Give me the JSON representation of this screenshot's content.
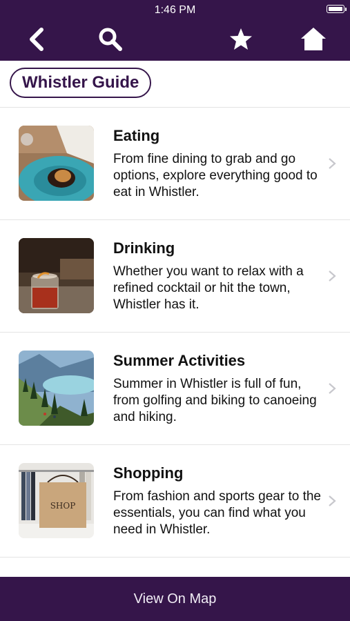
{
  "status_bar": {
    "time": "1:46 PM"
  },
  "nav": {
    "back_icon": "back-arrow-icon",
    "search_icon": "search-icon",
    "favorite_icon": "star-icon",
    "home_icon": "home-icon"
  },
  "filter": {
    "label": "Whistler Guide"
  },
  "items": [
    {
      "title": "Eating",
      "description": "From fine dining to grab and go options, explore everything good to eat in Whistler."
    },
    {
      "title": "Drinking",
      "description": "Whether you want to relax with a refined cocktail or hit the town, Whistler has it."
    },
    {
      "title": "Summer Activities",
      "description": "Summer in Whistler is full of fun, from golfing and biking to canoeing and hiking."
    },
    {
      "title": "Shopping",
      "description": "From fashion and sports gear to the essentials, you can find what you need in Whistler.",
      "image_text": "SHOP"
    }
  ],
  "footer": {
    "label": "View On Map"
  },
  "colors": {
    "brand": "#35154a",
    "divider": "#e4e4e4",
    "chevron": "#c7c7cc"
  }
}
